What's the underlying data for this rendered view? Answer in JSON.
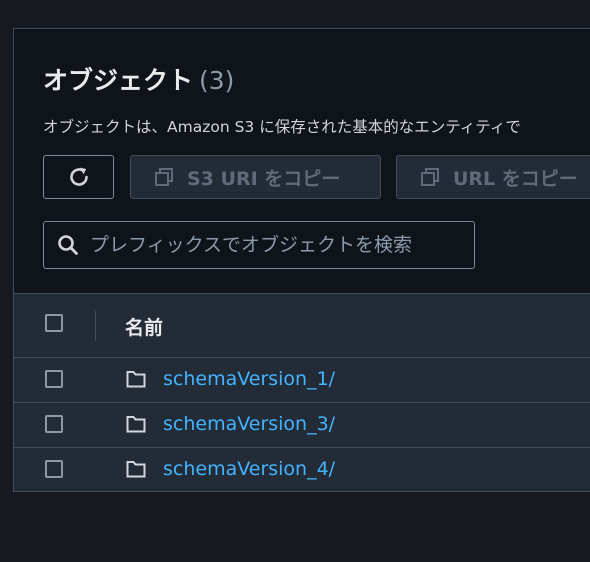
{
  "objects_panel": {
    "title": "オブジェクト",
    "count": "(3)",
    "description": "オブジェクトは、Amazon S3 に保存された基本的なエンティティで",
    "toolbar": {
      "refresh_icon": "refresh-icon",
      "copy_s3_uri_label": "S3 URI をコピー",
      "copy_url_label": "URL をコピー"
    },
    "search": {
      "placeholder": "プレフィックスでオブジェクトを検索",
      "value": ""
    },
    "table": {
      "columns": [
        "名前"
      ],
      "rows": [
        {
          "name": "schemaVersion_1/",
          "type_icon": "folder-icon"
        },
        {
          "name": "schemaVersion_3/",
          "type_icon": "folder-icon"
        },
        {
          "name": "schemaVersion_4/",
          "type_icon": "folder-icon"
        }
      ]
    }
  },
  "colors": {
    "page_background": "#161a20",
    "panel_background": "#0f141a",
    "table_background": "#232b37",
    "border": "#414d5c",
    "link": "#42b4ff",
    "disabled_text": "#5f6b7a",
    "heading_text": "#e9ebed",
    "muted_text": "#8d99a8"
  }
}
